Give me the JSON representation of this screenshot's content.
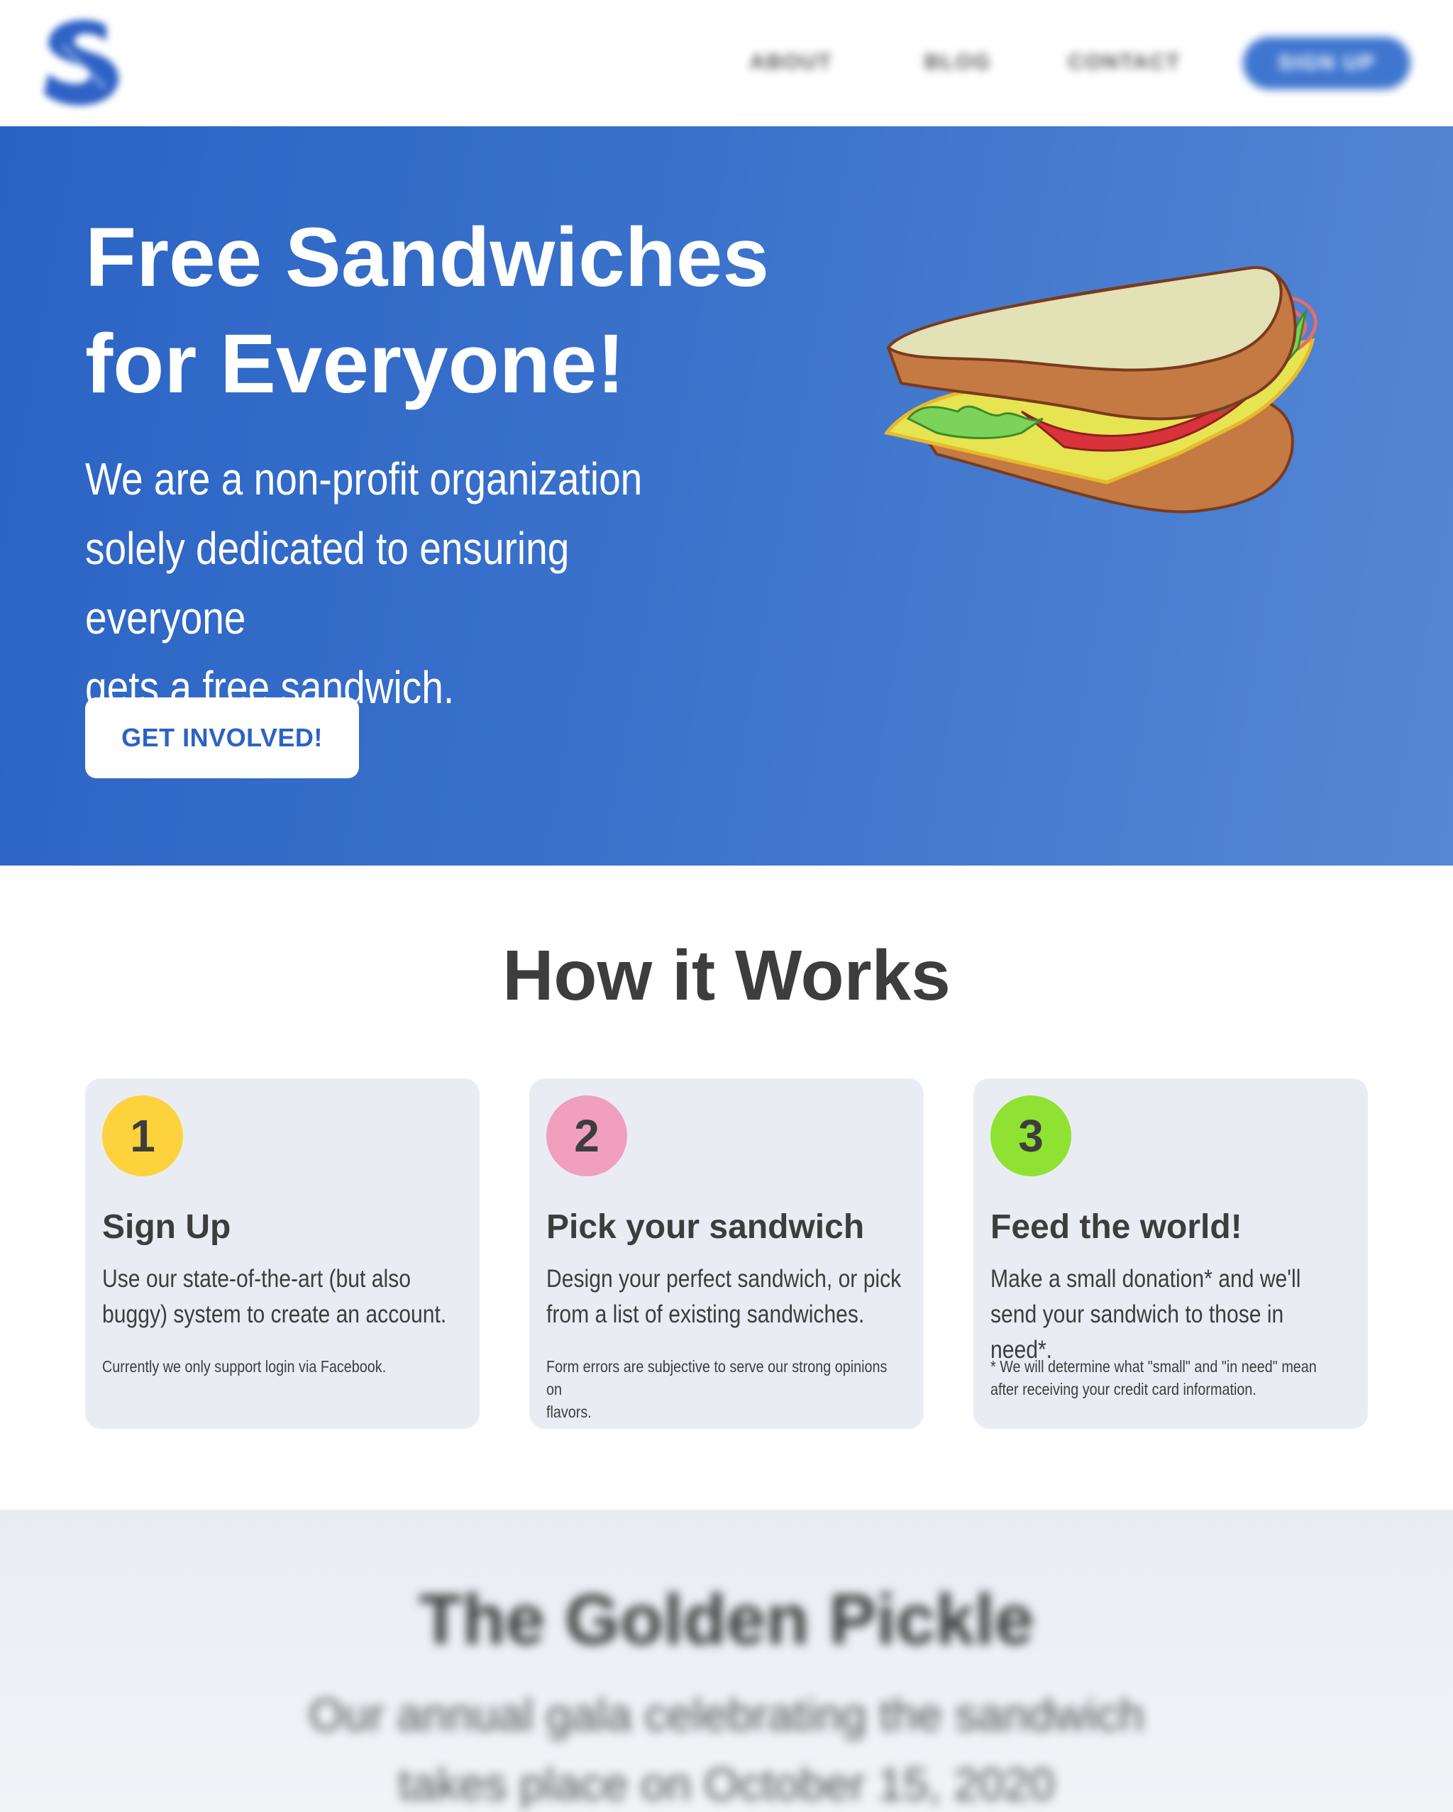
{
  "header": {
    "logo_name": "s-logo",
    "nav": {
      "about": "ABOUT",
      "blog": "BLOG",
      "contact": "CONTACT"
    },
    "signup_label": "SIGN UP"
  },
  "hero": {
    "title_line1": "Free Sandwiches",
    "title_line2": "for Everyone!",
    "sub_line1": "We are a non-profit organization",
    "sub_line2": "solely dedicated to ensuring everyone",
    "sub_line3": "gets a free sandwich.",
    "cta_label": "GET INVOLVED!",
    "illustration": "sandwich-illustration"
  },
  "how": {
    "title": "How it Works",
    "steps": [
      {
        "number": "1",
        "title": "Sign Up",
        "body_line1": "Use our state-of-the-art (but also",
        "body_line2": "buggy) system to create an account.",
        "note_line1": "Currently we only support login via Facebook.",
        "note_line2": ""
      },
      {
        "number": "2",
        "title": "Pick your sandwich",
        "body_line1": "Design your perfect sandwich, or pick",
        "body_line2": "from a list of existing sandwiches.",
        "note_line1": "Form errors are subjective to serve our strong opinions on",
        "note_line2": "flavors."
      },
      {
        "number": "3",
        "title": "Feed the world!",
        "body_line1": "Make a small donation* and we'll",
        "body_line2": "send your sandwich to those in need*.",
        "note_line1": "* We will determine what \"small\" and \"in need\" mean",
        "note_line2": "after receiving your credit card information."
      }
    ]
  },
  "gala": {
    "title": "The Golden Pickle",
    "text_line1": "Our annual gala celebrating the sandwich",
    "text_line2": "takes place on October 15, 2020"
  },
  "colors": {
    "brand_blue": "#2a63c4",
    "badge_yellow": "#fdd23c",
    "badge_pink": "#f09fbf",
    "badge_green": "#8fe231",
    "card_bg": "#e9edf3"
  }
}
